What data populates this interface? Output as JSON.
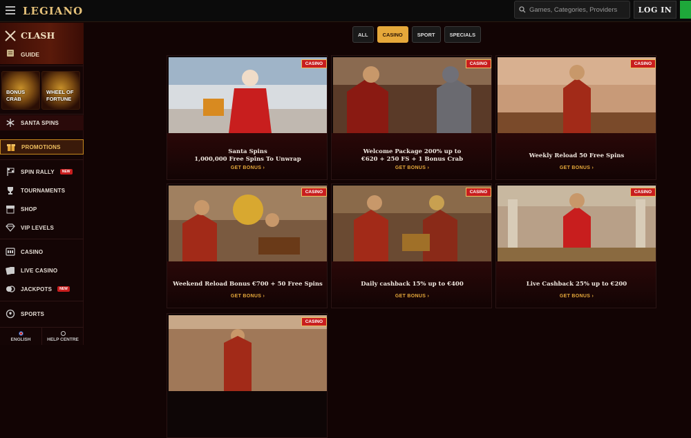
{
  "header": {
    "logo": "LEGIANO",
    "search_placeholder": "Games, Categories, Providers",
    "login_label": "LOG IN"
  },
  "sidebar": {
    "clash_label": "CLASH",
    "guide_label": "GUIDE",
    "tiles": [
      {
        "label_1": "BONUS",
        "label_2": "CRAB"
      },
      {
        "label_1": "WHEEL OF",
        "label_2": "FORTUNE"
      }
    ],
    "items": [
      {
        "label": "SANTA SPINS",
        "icon": "snowflake-icon"
      },
      {
        "label": "PROMOTIONS",
        "icon": "gift-icon"
      },
      {
        "label": "SPIN RALLY",
        "icon": "flag-icon",
        "badge": "NEW"
      },
      {
        "label": "TOURNAMENTS",
        "icon": "trophy-icon"
      },
      {
        "label": "SHOP",
        "icon": "shop-icon"
      },
      {
        "label": "VIP LEVELS",
        "icon": "diamond-icon"
      },
      {
        "label": "CASINO",
        "icon": "slot-icon"
      },
      {
        "label": "LIVE CASINO",
        "icon": "cards-icon"
      },
      {
        "label": "JACKPOTS",
        "icon": "coins-icon",
        "badge": "NEW"
      },
      {
        "label": "SPORTS",
        "icon": "ball-icon"
      }
    ],
    "footer": {
      "language": "ENGLISH",
      "help": "HELP CENTRE"
    }
  },
  "filters": [
    {
      "label": "ALL",
      "active": false
    },
    {
      "label": "CASINO",
      "active": true
    },
    {
      "label": "SPORT",
      "active": false
    },
    {
      "label": "SPECIALS",
      "active": false
    }
  ],
  "cards": [
    {
      "line1": "Santa Spins",
      "line2": "1,000,000 Free Spins To Unwrap",
      "cta": "GET BONUS",
      "tag": "CASINO"
    },
    {
      "line1": "Welcome Package 200% up to",
      "line2": "€620 + 250 FS + 1 Bonus Crab",
      "cta": "GET BONUS",
      "tag": "CASINO"
    },
    {
      "line1": "Weekly Reload 50 Free Spins",
      "line2": "",
      "cta": "GET BONUS",
      "tag": "CASINO"
    },
    {
      "line1": "Weekend Reload Bonus €700 + 50 Free Spins",
      "line2": "",
      "cta": "GET BONUS",
      "tag": "CASINO"
    },
    {
      "line1": "Daily cashback 15% up to €400",
      "line2": "",
      "cta": "GET BONUS",
      "tag": "CASINO"
    },
    {
      "line1": "Live Cashback 25% up to €200",
      "line2": "",
      "cta": "GET BONUS",
      "tag": "CASINO"
    },
    {
      "line1": "",
      "line2": "",
      "cta": "",
      "tag": "CASINO"
    }
  ],
  "colors": {
    "accent": "#e6a83a",
    "tag_red": "#c81e1e",
    "join_green": "#1ea83a"
  }
}
